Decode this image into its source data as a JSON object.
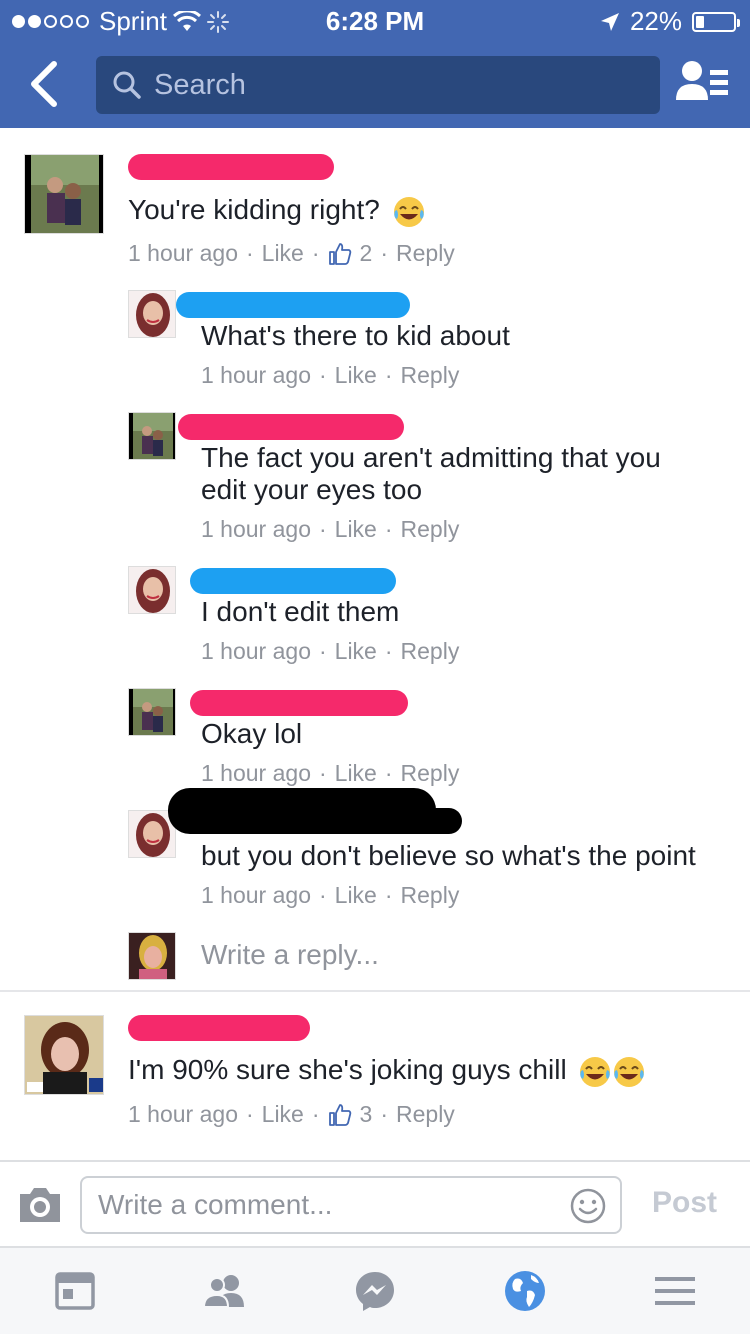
{
  "status_bar": {
    "carrier": "Sprint",
    "time": "6:28 PM",
    "battery": "22%",
    "battery_level": 0.22,
    "signal_bars": 2
  },
  "navbar": {
    "search_placeholder": "Search"
  },
  "comments": [
    {
      "text": "You're kidding right?",
      "emoji": "tears-of-joy",
      "time": "1 hour ago",
      "like": "Like",
      "reactions": "2",
      "reply": "Reply",
      "name_redaction": "pink"
    },
    {
      "text": "What's there to kid about",
      "time": "1 hour ago",
      "like": "Like",
      "reply": "Reply",
      "name_redaction": "blue"
    },
    {
      "text_line1": "The fact you aren't admitting that you",
      "text_line2": "edit your eyes too",
      "time": "1 hour ago",
      "like": "Like",
      "reply": "Reply",
      "name_redaction": "pink"
    },
    {
      "text": "I don't edit them",
      "time": "1 hour ago",
      "like": "Like",
      "reply": "Reply",
      "name_redaction": "blue"
    },
    {
      "text": "Okay lol",
      "time": "1 hour ago",
      "like": "Like",
      "reply": "Reply",
      "name_redaction": "pink"
    },
    {
      "text": "but you don't believe so what's the point",
      "time": "1 hour ago",
      "like": "Like",
      "reply": "Reply",
      "name_redaction": "black"
    },
    {
      "text": "I'm 90% sure she's joking guys chill",
      "emoji": "tears-of-joy",
      "time": "1 hour ago",
      "like": "Like",
      "reactions": "3",
      "reply": "Reply",
      "name_redaction": "pink"
    }
  ],
  "write_reply_placeholder": "Write a reply...",
  "composer": {
    "placeholder": "Write a comment...",
    "post_label": "Post"
  },
  "tabbar": {
    "tabs": [
      "news-feed-icon",
      "friends-icon",
      "messenger-icon",
      "globe-icon",
      "menu-icon"
    ],
    "active_tab": "globe-icon"
  },
  "colors": {
    "brand": "#4267b2",
    "search_bg": "#29487d",
    "redact_pink": "#f5296b",
    "redact_blue": "#1da0f2",
    "meta_gray": "#90949c",
    "active_tab": "#4a90e2"
  }
}
